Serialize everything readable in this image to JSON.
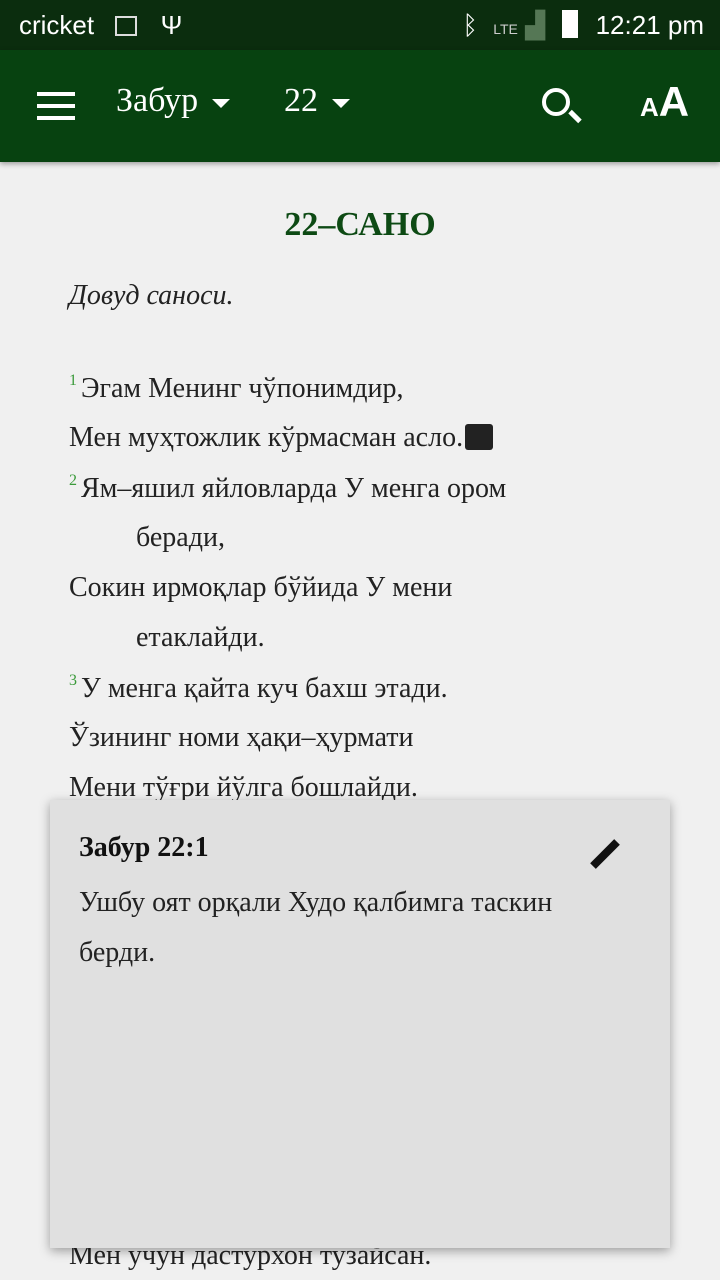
{
  "status": {
    "carrier": "cricket",
    "network": "LTE",
    "time": "12:21 pm",
    "icons": [
      "image-icon",
      "usb-icon",
      "bluetooth-icon",
      "signal-icon",
      "battery-icon"
    ]
  },
  "toolbar": {
    "book": "Забур",
    "chapter": "22",
    "icons": [
      "menu-icon",
      "search-icon",
      "text-size-icon"
    ]
  },
  "content": {
    "title": "22–САНО",
    "subtitle": "Довуд саноси.",
    "lines": [
      {
        "verse": "1",
        "text": "Эгам Менинг чўпонимдир,"
      },
      {
        "text": "Мен муҳтожлик кўрмасман асло."
      },
      {
        "verse": "2",
        "text": "Ям–яшил яйловларда У менга ором"
      },
      {
        "text": "беради,"
      },
      {
        "text": "Сокин ирмоқлар бўйида У мени"
      },
      {
        "text": "етаклайди."
      },
      {
        "verse": "3",
        "text": "У менга қайта куч бахш этади."
      },
      {
        "text": "Ўзининг номи ҳақи–ҳурмати"
      },
      {
        "text": "Мени тўғри йўлга бошлайди."
      },
      {
        "text": "Мен учун дастурхон тузайсан."
      }
    ]
  },
  "note": {
    "reference": "Забур 22:1",
    "text": "Ушбу оят орқали Худо қалбимга таскин берди."
  },
  "colors": {
    "toolbar": "#074210",
    "status": "#0b2d0e",
    "title": "#0d4a14",
    "verse_number": "#3a9a3a"
  }
}
